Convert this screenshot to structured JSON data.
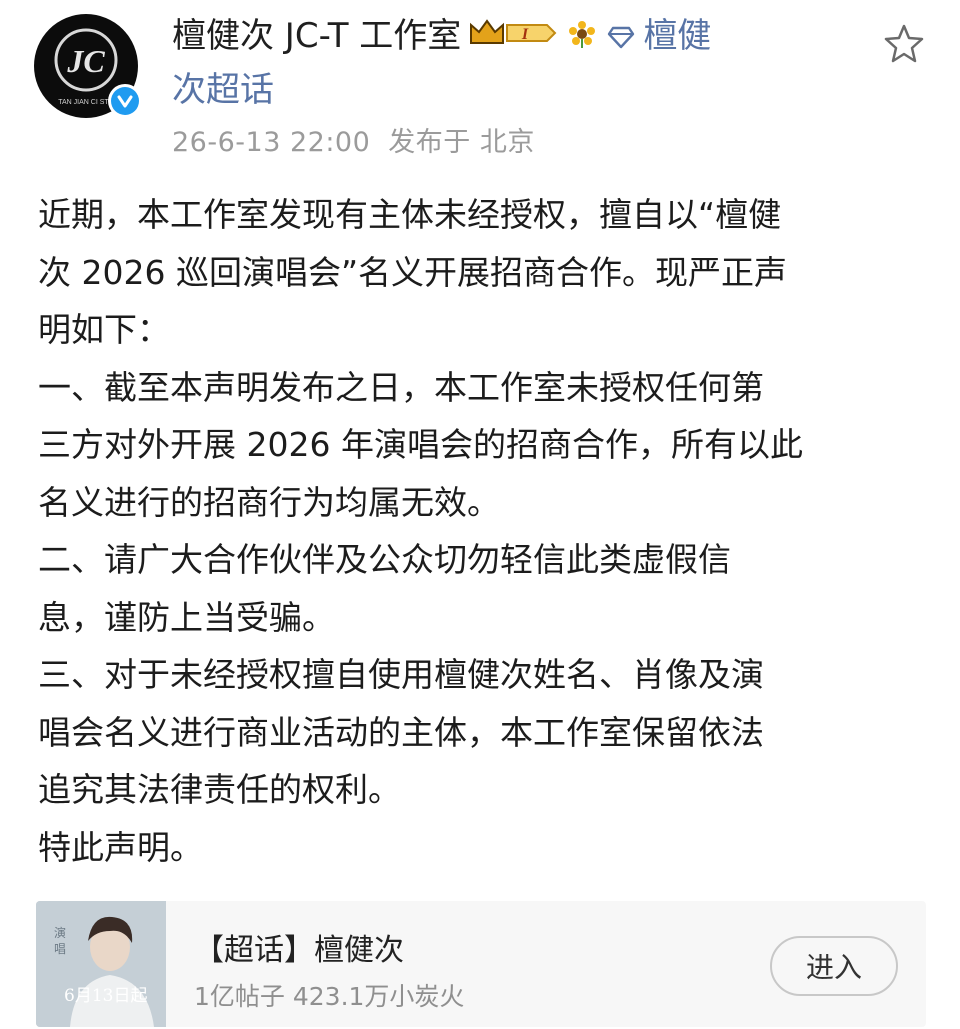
{
  "author": {
    "name": "檀健次 JC-T 工作室",
    "avatar_text": "TAN JIAN CI STU",
    "crown_level": "I",
    "topic_tag": "檀健",
    "topic_tag_cont": "次超话",
    "verified": true
  },
  "meta": {
    "timestamp": "26-6-13 22:00",
    "location": "发布于 北京"
  },
  "post": {
    "lines": [
      "近期，本工作室发现有主体未经授权，擅自以“檀健",
      "次 2026 巡回演唱会”名义开展招商合作。现严正声",
      "明如下：",
      "一、截至本声明发布之日，本工作室未授权任何第",
      "三方对外开展 2026 年演唱会的招商合作，所有以此",
      "名义进行的招商行为均属无效。",
      "二、请广大合作伙伴及公众切勿轻信此类虚假信",
      "息，谨防上当受骗。",
      "三、对于未经授权擅自使用檀健次姓名、肖像及演",
      "唱会名义进行商业活动的主体，本工作室保留依法",
      "追究其法律责任的权利。",
      "特此声明。"
    ]
  },
  "supertopic_card": {
    "title": "【超话】檀健次",
    "stats": "1亿帖子 423.1万小炭火",
    "thumb_caption": "6月13日起",
    "enter_label": "进入"
  },
  "colors": {
    "link": "#5874a6",
    "meta": "#9b9b9b",
    "verified": "#1f9bf0",
    "crown": "#e3a21a"
  }
}
